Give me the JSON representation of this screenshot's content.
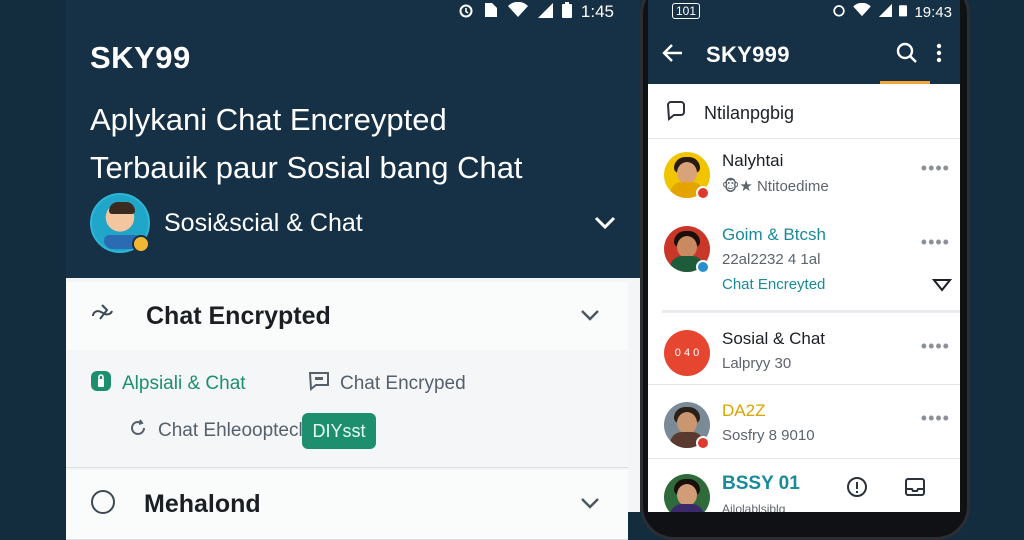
{
  "left_panel": {
    "status_time": "1:45",
    "app_title": "SKY99",
    "subtitle_line1": "Aplykani Chat Encreypted",
    "subtitle_line2": "Terbauik paur Sosial bang Chat",
    "account_label": "Sosi&scial & Chat",
    "sections": [
      {
        "label": "Chat Encrypted"
      },
      {
        "label": "Mehalond"
      }
    ],
    "options": {
      "opt1": "Alpsiali & Chat",
      "opt2": "Chat Encryped",
      "opt3": "Chat Ehleooptecl",
      "chip": "DIYsst"
    }
  },
  "phone": {
    "status_left": "101",
    "status_time": "19:43",
    "toolbar_title": "SKY999",
    "filter_label": "Ntilanpgbig",
    "chats": [
      {
        "name": "Nalyhtai",
        "sub": "🐵★ Ntitoedime",
        "avatar_color": "#f1c400",
        "dot_color": "#e03a2e"
      },
      {
        "name": "Goim & Btcsh",
        "line2": "22al2232 4 1al",
        "line3": "Chat Encreyted",
        "avatar_color": "#c83728",
        "dot_color": "#2a8fd0"
      },
      {
        "name": "Sosial & Chat",
        "sub": "Lalpryy 30",
        "avatar_label": "0 4 0",
        "avatar_color": "#e6452f"
      },
      {
        "name": "DA2Z",
        "sub": "Sosfry 8 9010",
        "avatar_color": "#6c4c3c",
        "dot_color": "#e03a2e"
      },
      {
        "name": "BSSY 01",
        "sub": "Ailolablsiblg",
        "avatar_color": "#2e6a3a"
      }
    ],
    "accent_color": "#1a8a9a",
    "header_color": "#163045"
  }
}
